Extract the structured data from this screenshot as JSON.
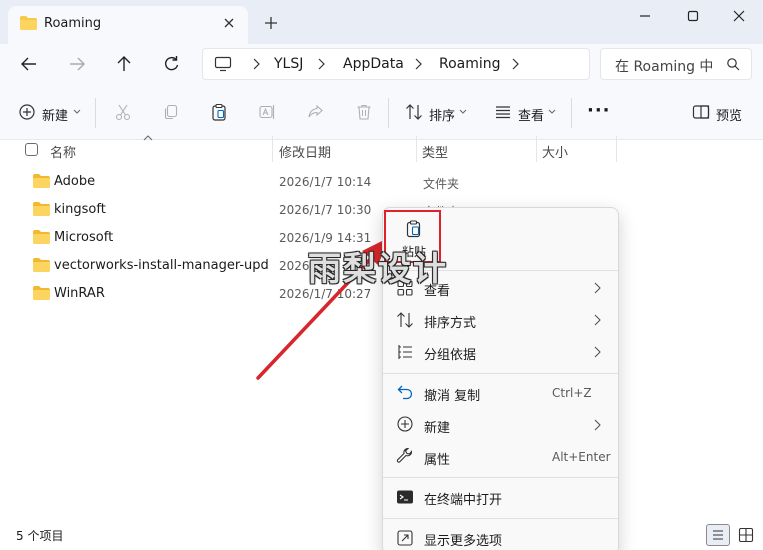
{
  "tab": {
    "title": "Roaming"
  },
  "window": {
    "minimize_icon": "minimize-icon",
    "maximize_icon": "maximize-icon",
    "close_icon": "close-icon"
  },
  "breadcrumb": [
    "YLSJ",
    "AppData",
    "Roaming"
  ],
  "search": {
    "placeholder": "在 Roaming 中"
  },
  "toolbar": {
    "new_label": "新建",
    "sort_label": "排序",
    "view_label": "查看",
    "preview_label": "预览",
    "more": "···"
  },
  "columns": [
    "名称",
    "修改日期",
    "类型",
    "大小"
  ],
  "files": [
    {
      "name": "Adobe",
      "date": "2026/1/7 10:14",
      "type": "文件夹"
    },
    {
      "name": "kingsoft",
      "date": "2026/1/7 10:30",
      "type": "文件夹"
    },
    {
      "name": "Microsoft",
      "date": "2026/1/9 14:31",
      "type": ""
    },
    {
      "name": "vectorworks-install-manager-upda...",
      "date": "2026/1/7",
      "type": ""
    },
    {
      "name": "WinRAR",
      "date": "2026/1/7 10:27",
      "type": ""
    }
  ],
  "status": {
    "count_text": "5 个项目"
  },
  "context_menu": {
    "paste_label": "粘贴",
    "items": [
      {
        "label": "查看",
        "icon": "grid-icon",
        "submenu": true
      },
      {
        "label": "排序方式",
        "icon": "sort-icon",
        "submenu": true
      },
      {
        "label": "分组依据",
        "icon": "group-icon",
        "submenu": true
      },
      {
        "label": "撤消 复制",
        "icon": "undo-icon",
        "shortcut": "Ctrl+Z"
      },
      {
        "label": "新建",
        "icon": "plus-circle-icon",
        "submenu": true
      },
      {
        "label": "属性",
        "icon": "wrench-icon",
        "shortcut": "Alt+Enter"
      },
      {
        "label": "在终端中打开",
        "icon": "terminal-icon"
      },
      {
        "label": "显示更多选项",
        "icon": "more-options-icon"
      }
    ]
  },
  "watermark": "雨梨设计",
  "colors": {
    "accent": "#0067c0",
    "highlight": "#e0202a",
    "folder": "#f7c948"
  }
}
